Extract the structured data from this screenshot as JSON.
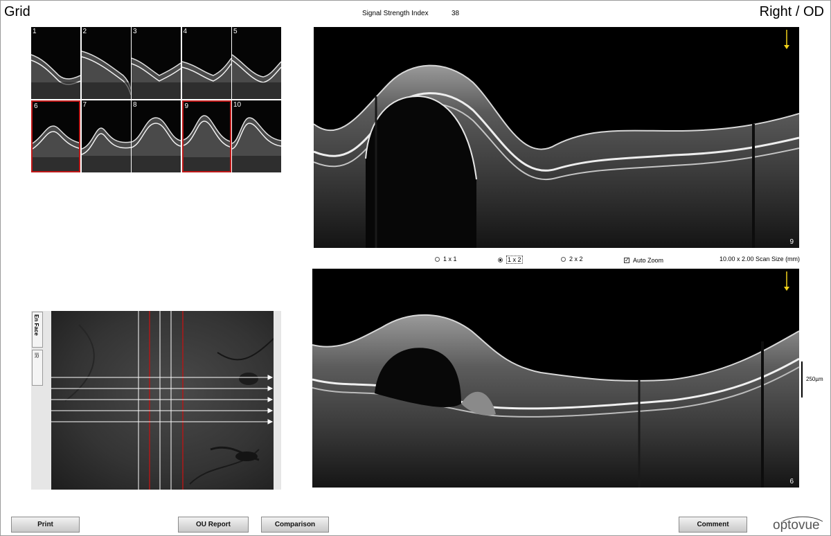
{
  "header": {
    "title_left": "Grid",
    "title_right": "Right / OD",
    "ssi_label": "Signal Strength Index",
    "ssi_value": "38"
  },
  "thumbnails": [
    {
      "label": "1",
      "selected": false
    },
    {
      "label": "2",
      "selected": false
    },
    {
      "label": "3",
      "selected": false
    },
    {
      "label": "4",
      "selected": false
    },
    {
      "label": "5",
      "selected": false
    },
    {
      "label": "6",
      "selected": true
    },
    {
      "label": "7",
      "selected": false
    },
    {
      "label": "8",
      "selected": false
    },
    {
      "label": "9",
      "selected": true
    },
    {
      "label": "10",
      "selected": false
    }
  ],
  "enface": {
    "tab_enface": "En Face",
    "tab_ir": "IR",
    "line_color_white": "#ffffff",
    "line_color_red": "#b01818"
  },
  "bscan_top": {
    "number": "9"
  },
  "bscan_bottom": {
    "number": "6"
  },
  "layout_options": {
    "opt_1x1": "1 x 1",
    "opt_1x2": "1 x 2",
    "opt_2x2": "2 x 2",
    "selected": "1 x 2",
    "auto_zoom_label": "Auto Zoom",
    "auto_zoom_checked": true,
    "scan_size": "10.00 x 2.00 Scan Size (mm)"
  },
  "scale_bar": {
    "label": "250µm"
  },
  "buttons": {
    "print": "Print",
    "ou_report": "OU Report",
    "comparison": "Comparison",
    "comment": "Comment"
  },
  "logo": {
    "text": "optovue"
  },
  "colors": {
    "selection_red": "#c01818",
    "marker_yellow": "#f2d21a"
  }
}
